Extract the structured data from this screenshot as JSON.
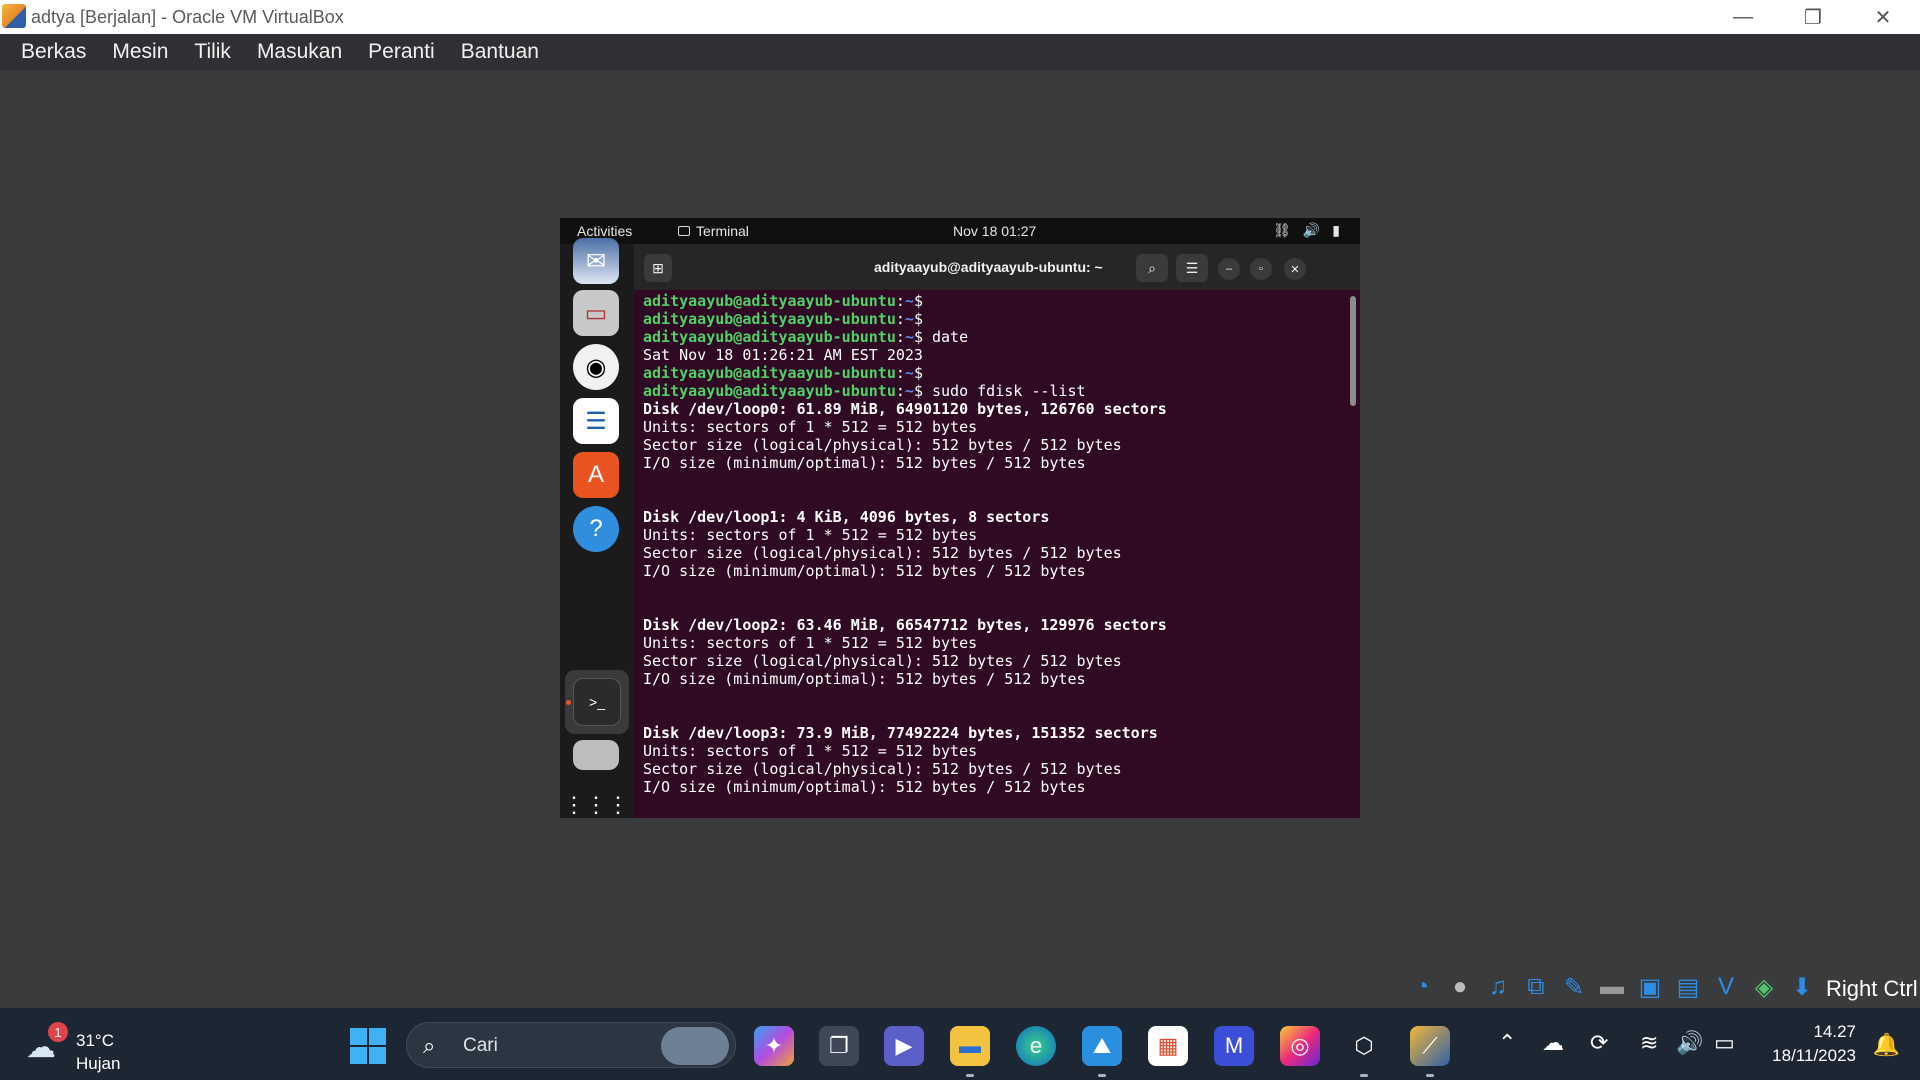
{
  "window": {
    "title": "adtya [Berjalan] - Oracle VM VirtualBox",
    "controls": {
      "minimize": "—",
      "restore": "❐",
      "close": "✕"
    }
  },
  "menubar": [
    "Berkas",
    "Mesin",
    "Tilik",
    "Masukan",
    "Peranti",
    "Bantuan"
  ],
  "guest": {
    "topbar": {
      "activities": "Activities",
      "app": "Terminal",
      "clock": "Nov 18  01:27"
    },
    "terminal": {
      "title": "adityaayub@adityaayub-ubuntu: ~",
      "prompt_user": "adityaayub@adityaayub-ubuntu",
      "prompt_path": "~",
      "lines": [
        {
          "type": "prompt",
          "cmd": ""
        },
        {
          "type": "prompt",
          "cmd": ""
        },
        {
          "type": "prompt",
          "cmd": "date"
        },
        {
          "type": "out",
          "text": "Sat Nov 18 01:26:21 AM EST 2023"
        },
        {
          "type": "prompt",
          "cmd": ""
        },
        {
          "type": "prompt",
          "cmd": "sudo fdisk --list"
        },
        {
          "type": "bold",
          "text": "Disk /dev/loop0: 61.89 MiB, 64901120 bytes, 126760 sectors"
        },
        {
          "type": "out",
          "text": "Units: sectors of 1 * 512 = 512 bytes"
        },
        {
          "type": "out",
          "text": "Sector size (logical/physical): 512 bytes / 512 bytes"
        },
        {
          "type": "out",
          "text": "I/O size (minimum/optimal): 512 bytes / 512 bytes"
        },
        {
          "type": "out",
          "text": ""
        },
        {
          "type": "out",
          "text": ""
        },
        {
          "type": "bold",
          "text": "Disk /dev/loop1: 4 KiB, 4096 bytes, 8 sectors"
        },
        {
          "type": "out",
          "text": "Units: sectors of 1 * 512 = 512 bytes"
        },
        {
          "type": "out",
          "text": "Sector size (logical/physical): 512 bytes / 512 bytes"
        },
        {
          "type": "out",
          "text": "I/O size (minimum/optimal): 512 bytes / 512 bytes"
        },
        {
          "type": "out",
          "text": ""
        },
        {
          "type": "out",
          "text": ""
        },
        {
          "type": "bold",
          "text": "Disk /dev/loop2: 63.46 MiB, 66547712 bytes, 129976 sectors"
        },
        {
          "type": "out",
          "text": "Units: sectors of 1 * 512 = 512 bytes"
        },
        {
          "type": "out",
          "text": "Sector size (logical/physical): 512 bytes / 512 bytes"
        },
        {
          "type": "out",
          "text": "I/O size (minimum/optimal): 512 bytes / 512 bytes"
        },
        {
          "type": "out",
          "text": ""
        },
        {
          "type": "out",
          "text": ""
        },
        {
          "type": "bold",
          "text": "Disk /dev/loop3: 73.9 MiB, 77492224 bytes, 151352 sectors"
        },
        {
          "type": "out",
          "text": "Units: sectors of 1 * 512 = 512 bytes"
        },
        {
          "type": "out",
          "text": "Sector size (logical/physical): 512 bytes / 512 bytes"
        },
        {
          "type": "out",
          "text": "I/O size (minimum/optimal): 512 bytes / 512 bytes"
        }
      ]
    },
    "dock": [
      "thunderbird-icon",
      "files-icon",
      "rhythmbox-icon",
      "writer-icon",
      "app-center-icon",
      "help-icon",
      "terminal-icon",
      "disk-icon",
      "app-grid-icon"
    ]
  },
  "vbox_status": {
    "host_key": "Right Ctrl"
  },
  "taskbar": {
    "weather": {
      "badge": "1",
      "temp": "31°C",
      "condition": "Hujan"
    },
    "search_placeholder": "Cari",
    "time": "14.27",
    "date": "18/11/2023"
  },
  "colors": {
    "terminal_bg": "#300a24",
    "prompt_user": "#4fd165",
    "prompt_path": "#5b8de2",
    "ubuntu_orange": "#e95420"
  }
}
